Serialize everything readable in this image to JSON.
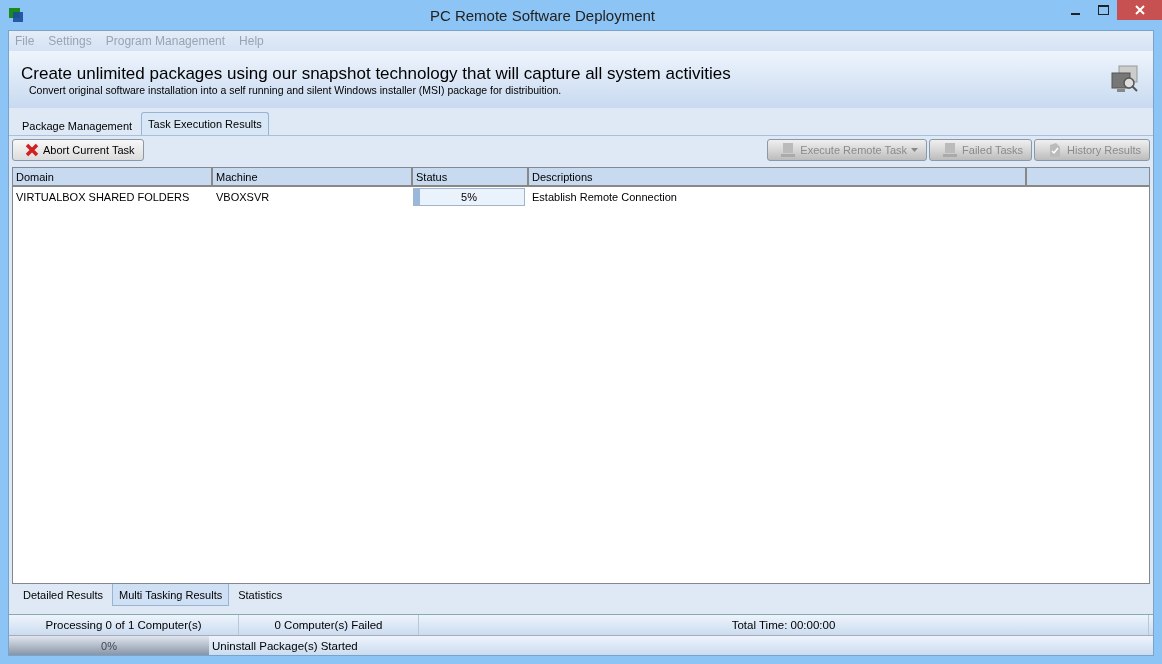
{
  "window": {
    "title": "PC Remote Software Deployment"
  },
  "menu": [
    {
      "label": "File",
      "disabled": true
    },
    {
      "label": "Settings",
      "disabled": true
    },
    {
      "label": "Program Management",
      "disabled": true
    },
    {
      "label": "Help",
      "disabled": true
    }
  ],
  "banner": {
    "headline": "Create unlimited packages using our snapshot technology that will capture all system activities",
    "subtitle": "Convert original software installation into a self running and silent Windows installer (MSI) package for distribuition."
  },
  "tabs": [
    {
      "label": "Package Management",
      "selected": false
    },
    {
      "label": "Task Execution Results",
      "selected": true
    }
  ],
  "toolbar": [
    {
      "label": "Abort Current Task",
      "kind": "abort",
      "disabled": false
    },
    {
      "label": "Execute Remote Task",
      "kind": "execute",
      "disabled": true
    },
    {
      "label": "Failed Tasks",
      "kind": "failed",
      "disabled": true
    },
    {
      "label": "History Results",
      "kind": "history",
      "disabled": true
    }
  ],
  "table": {
    "columns": [
      "Domain",
      "Machine",
      "Status",
      "Descriptions"
    ],
    "rows": [
      {
        "domain": "VIRTUALBOX SHARED FOLDERS",
        "machine": "VBOXSVR",
        "status": {
          "level": 0.05,
          "reading": "5%"
        },
        "description": "Establish Remote Connection"
      }
    ]
  },
  "bottom_tabs": [
    {
      "label": "Detailed Results",
      "selected": false
    },
    {
      "label": "Multi Tasking Results",
      "selected": true
    },
    {
      "label": "Statistics",
      "selected": false
    }
  ],
  "status_bar": {
    "processing": "Processing 0 of 1 Computer(s)",
    "failed": "0 Computer(s) Failed",
    "total_time": "Total Time: 00:00:00",
    "progress": {
      "level": 0,
      "reading": "0%"
    },
    "message": "Uninstall Package(s) Started"
  }
}
